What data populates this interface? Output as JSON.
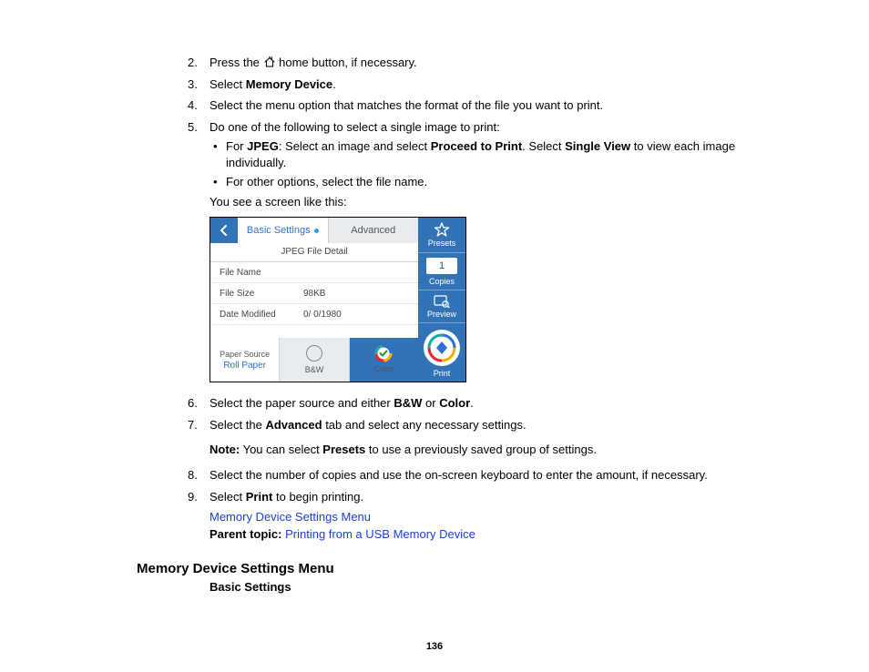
{
  "steps": {
    "s2_a": "Press the ",
    "s2_b": " home button, if necessary.",
    "s3_a": "Select ",
    "s3_b": "Memory Device",
    "s3_c": ".",
    "s4": "Select the menu option that matches the format of the file you want to print.",
    "s5": "Do one of the following to select a single image to print:",
    "s5_bul1_a": "For ",
    "s5_bul1_b": "JPEG",
    "s5_bul1_c": ": Select an image and select ",
    "s5_bul1_d": "Proceed to Print",
    "s5_bul1_e": ". Select ",
    "s5_bul1_f": "Single View",
    "s5_bul1_g": " to view each image individually.",
    "s5_bul2": "For other options, select the file name.",
    "s5_after": "You see a screen like this:",
    "s6_a": "Select the paper source and either ",
    "s6_b": "B&W",
    "s6_c": " or ",
    "s6_d": "Color",
    "s6_e": ".",
    "s7_a": "Select the ",
    "s7_b": "Advanced",
    "s7_c": " tab and select any necessary settings.",
    "note_a": "Note:",
    "note_b": " You can select ",
    "note_c": "Presets",
    "note_d": " to use a previously saved group of settings.",
    "s8": "Select the number of copies and use the on-screen keyboard to enter the amount, if necessary.",
    "s9_a": "Select ",
    "s9_b": "Print",
    "s9_c": " to begin printing."
  },
  "links": {
    "menu": "Memory Device Settings Menu",
    "parent_label": "Parent topic:",
    "parent_link": "Printing from a USB Memory Device"
  },
  "heading": "Memory Device Settings Menu",
  "sub_heading": "Basic Settings",
  "page_number": "136",
  "device": {
    "tab_active": "Basic Settings",
    "tab_inactive": "Advanced",
    "subtitle": "JPEG File Detail",
    "row1_label": "File Name",
    "row1_value": "",
    "row2_label": "File Size",
    "row2_value": "98KB",
    "row3_label": "Date Modified",
    "row3_value": "0/ 0/1980",
    "paper_source_label": "Paper Source",
    "paper_source_value": "Roll Paper",
    "bw_label": "B&W",
    "color_label": "Color",
    "side_presets": "Presets",
    "side_copies_value": "1",
    "side_copies_label": "Copies",
    "side_preview": "Preview",
    "side_print": "Print"
  }
}
